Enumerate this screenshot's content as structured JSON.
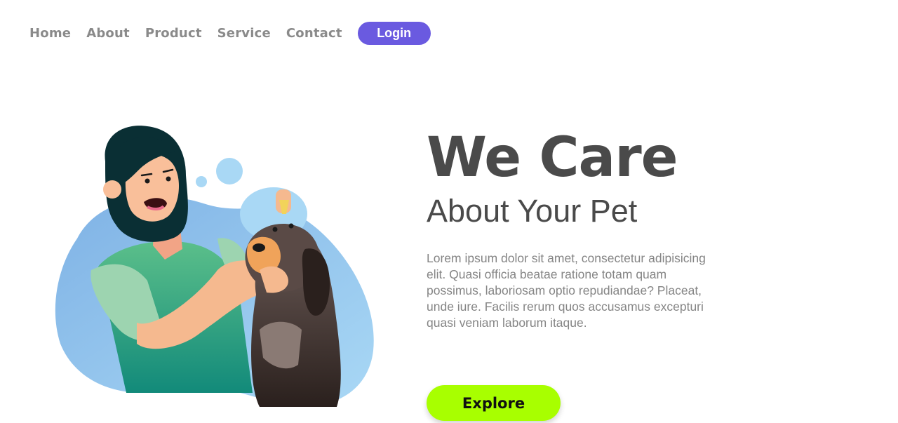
{
  "nav": {
    "links": [
      "Home",
      "About",
      "Product",
      "Service",
      "Contact"
    ],
    "login_label": "Login"
  },
  "hero": {
    "headline": "We Care",
    "subheadline": "About Your Pet",
    "body": "Lorem ipsum dolor sit amet, consectetur adipisicing elit. Quasi officia beatae ratione totam quam possimus, laboriosam optio repudiandae? Placeat, unde iure. Facilis rerum quos accusamus excepturi quasi veniam laborum itaque.",
    "cta_label": "Explore"
  },
  "colors": {
    "accent": "#6a5ae0",
    "cta": "#a8ff00",
    "heading": "#4a4a4a",
    "muted": "#8a8a8a"
  }
}
